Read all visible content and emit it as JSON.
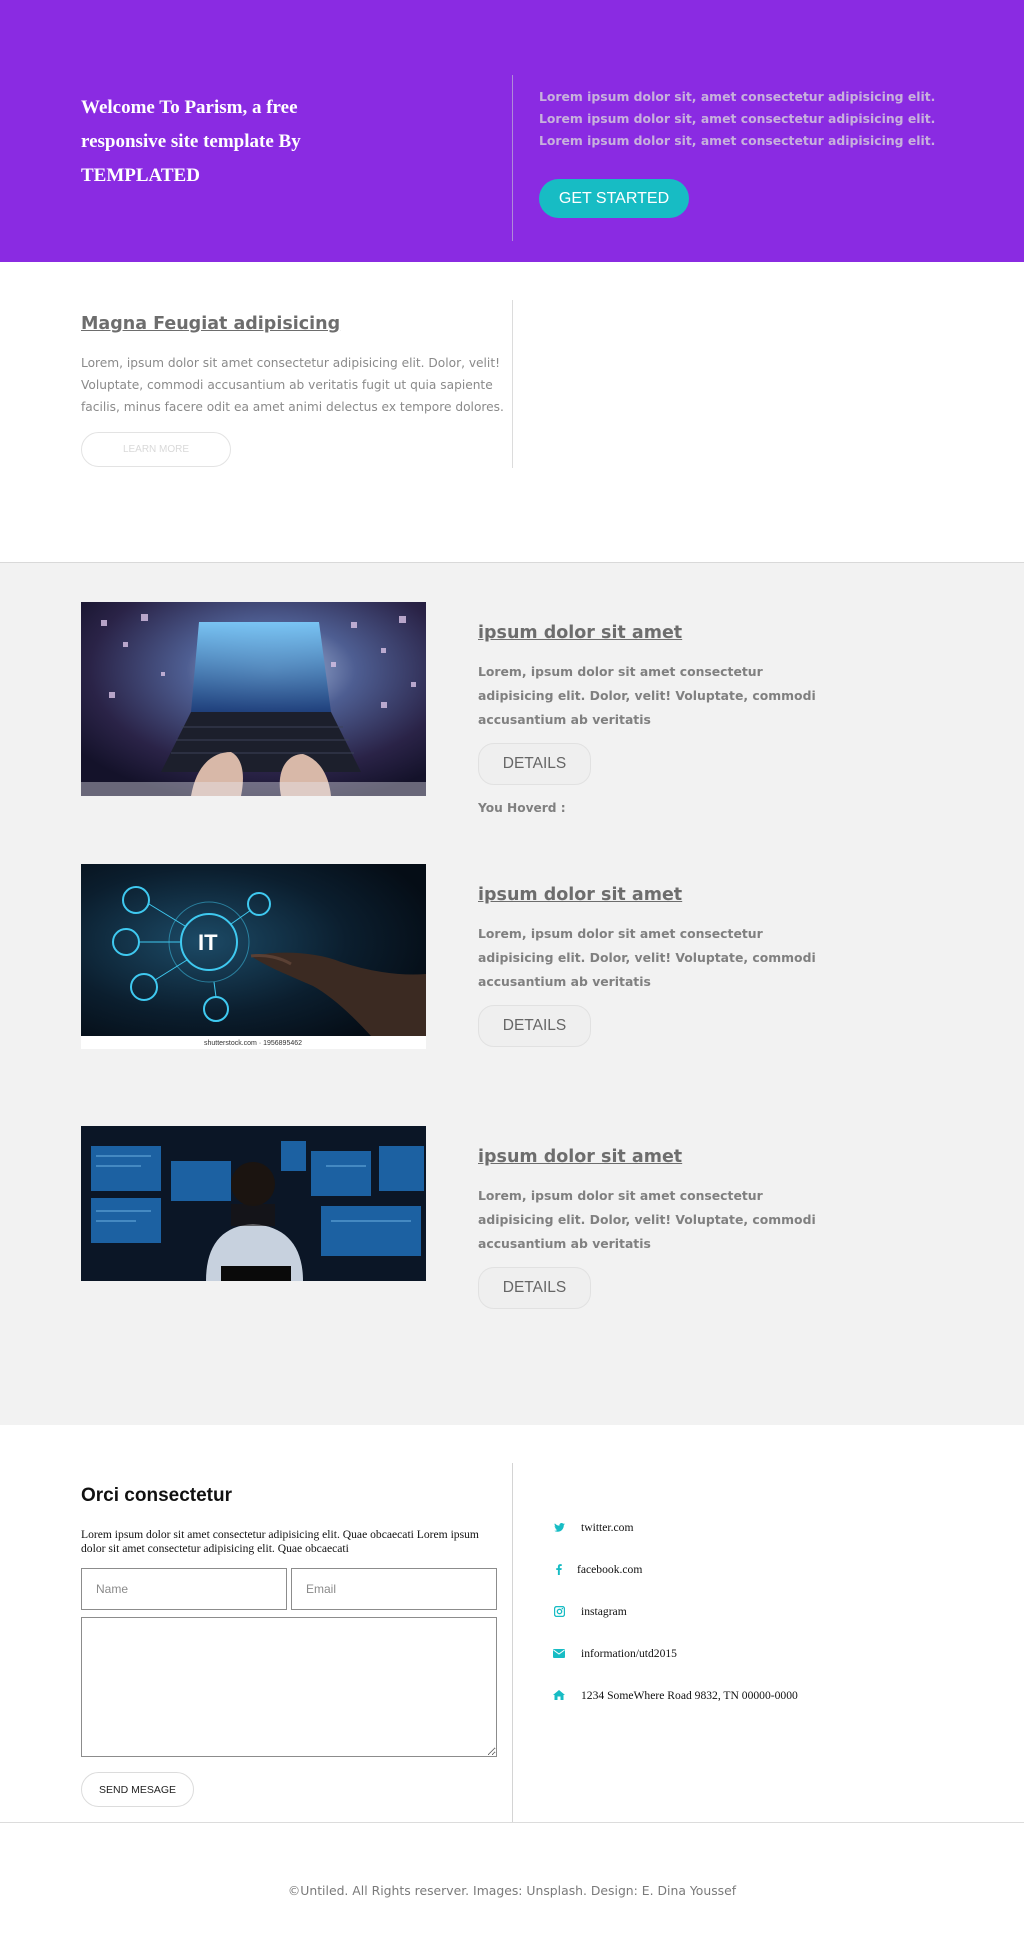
{
  "hero": {
    "title": "Welcome To Parism, a free responsive site template By TEMPLATED",
    "lines": [
      "Lorem ipsum dolor sit, amet consectetur adipisicing elit.",
      "Lorem ipsum dolor sit, amet consectetur adipisicing elit.",
      "Lorem ipsum dolor sit, amet consectetur adipisicing elit."
    ],
    "button": "GET STARTED"
  },
  "intro": {
    "title": "Magna Feugiat adipisicing",
    "text": "Lorem, ipsum dolor sit amet consectetur adipisicing elit. Dolor, velit! Voluptate, commodi accusantium ab veritatis fugit ut quia sapiente facilis, minus facere odit ea amet animi delectus ex tempore dolores.",
    "button": "LEARN MORE"
  },
  "items": [
    {
      "title": "ipsum dolor sit amet",
      "text": "Lorem, ipsum dolor sit amet consectetur adipisicing elit. Dolor, velit! Voluptate, commodi accusantium ab veritatis",
      "button": "DETAILS",
      "image": "laptop-typing-photo"
    },
    {
      "title": "ipsum dolor sit amet",
      "text": "Lorem, ipsum dolor sit amet consectetur adipisicing elit. Dolor, velit! Voluptate, commodi accusantium ab veritatis",
      "button": "DETAILS",
      "image": "it-touch-screen-photo",
      "caption": "shutterstock.com · 1956895462",
      "hub_label": "IT"
    },
    {
      "title": "ipsum dolor sit amet",
      "text": "Lorem, ipsum dolor sit amet consectetur adipisicing elit. Dolor, velit! Voluptate, commodi accusantium ab veritatis",
      "button": "DETAILS",
      "image": "monitoring-room-photo"
    }
  ],
  "hover_label": "You Hoverd :",
  "contact": {
    "title": "Orci consectetur",
    "text": "Lorem ipsum dolor sit amet consectetur adipisicing elit. Quae obcaecati Lorem ipsum dolor sit amet consectetur adipisicing elit. Quae obcaecati",
    "name_placeholder": "Name",
    "email_placeholder": "Email",
    "message_value": "",
    "send_button": "SEND MESAGE",
    "links": [
      {
        "icon": "twitter-icon",
        "label": "twitter.com"
      },
      {
        "icon": "facebook-icon",
        "label": "facebook.com"
      },
      {
        "icon": "instagram-icon",
        "label": "instagram"
      },
      {
        "icon": "envelope-icon",
        "label": "information/utd2015"
      },
      {
        "icon": "home-icon",
        "label": "1234 SomeWhere Road 9832, TN 00000-0000"
      }
    ]
  },
  "footer": "©Untiled. All Rights reserver. Images: Unsplash. Design: E. Dina Youssef",
  "colors": {
    "hero_bg": "#8a2be2",
    "accent": "#17bcc4",
    "section_bg": "#f2f2f2",
    "text_gray": "#6d6d6d"
  }
}
